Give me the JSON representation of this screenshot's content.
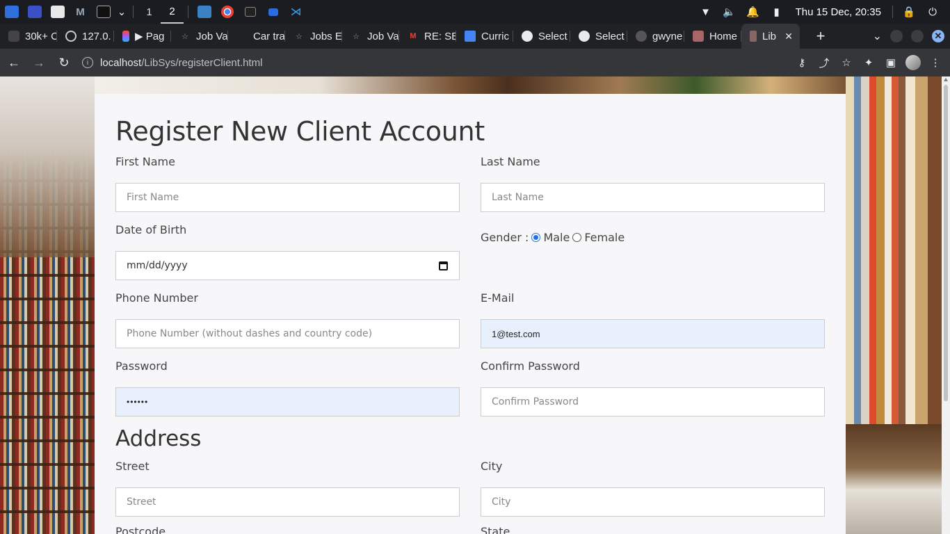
{
  "taskbar": {
    "workspaces": [
      "1",
      "2"
    ],
    "active_workspace": "2",
    "clock": "Thu 15 Dec, 20:35",
    "tray_icons": [
      "wifi-icon",
      "volume-icon",
      "bell-icon",
      "battery-icon",
      "lock-icon",
      "power-icon"
    ]
  },
  "tabs": [
    {
      "label": "30k+ C",
      "icon": "tab-favicon"
    },
    {
      "label": "127.0.",
      "icon": "globe-icon"
    },
    {
      "label": "▶ Pag",
      "icon": "figma-icon"
    },
    {
      "label": "Job Va",
      "icon": "star-icon"
    },
    {
      "label": "Car tra",
      "icon": "blank-icon"
    },
    {
      "label": "Jobs E",
      "icon": "star-icon"
    },
    {
      "label": "Job Va",
      "icon": "star-icon"
    },
    {
      "label": "RE: SE",
      "icon": "gmail-icon"
    },
    {
      "label": "Curric",
      "icon": "docs-icon"
    },
    {
      "label": "Select",
      "icon": "globe-icon"
    },
    {
      "label": "Select",
      "icon": "globe-icon"
    },
    {
      "label": "gwyne",
      "icon": "github-icon"
    },
    {
      "label": "Home",
      "icon": "photo-icon"
    },
    {
      "label": "Lib",
      "icon": "library-icon",
      "active": true
    }
  ],
  "addressbar": {
    "host": "localhost",
    "path": "/LibSys/registerClient.html"
  },
  "form": {
    "title": "Register New Client Account",
    "first_name": {
      "label": "First Name",
      "placeholder": "First Name"
    },
    "last_name": {
      "label": "Last Name",
      "placeholder": "Last Name"
    },
    "dob": {
      "label": "Date of Birth",
      "placeholder": "mm/dd/yyyy"
    },
    "gender": {
      "label": "Gender :",
      "options": [
        "Male",
        "Female"
      ],
      "selected": "Male"
    },
    "phone": {
      "label": "Phone Number",
      "placeholder": "Phone Number (without dashes and country code)"
    },
    "email": {
      "label": "E-Mail",
      "value": "1@test.com"
    },
    "password": {
      "label": "Password",
      "value": "••••••"
    },
    "confirm_password": {
      "label": "Confirm Password",
      "placeholder": "Confirm Password"
    },
    "address_heading": "Address",
    "street": {
      "label": "Street",
      "placeholder": "Street"
    },
    "city": {
      "label": "City",
      "placeholder": "City"
    },
    "postcode": {
      "label": "Postcode"
    },
    "state": {
      "label": "State"
    }
  }
}
